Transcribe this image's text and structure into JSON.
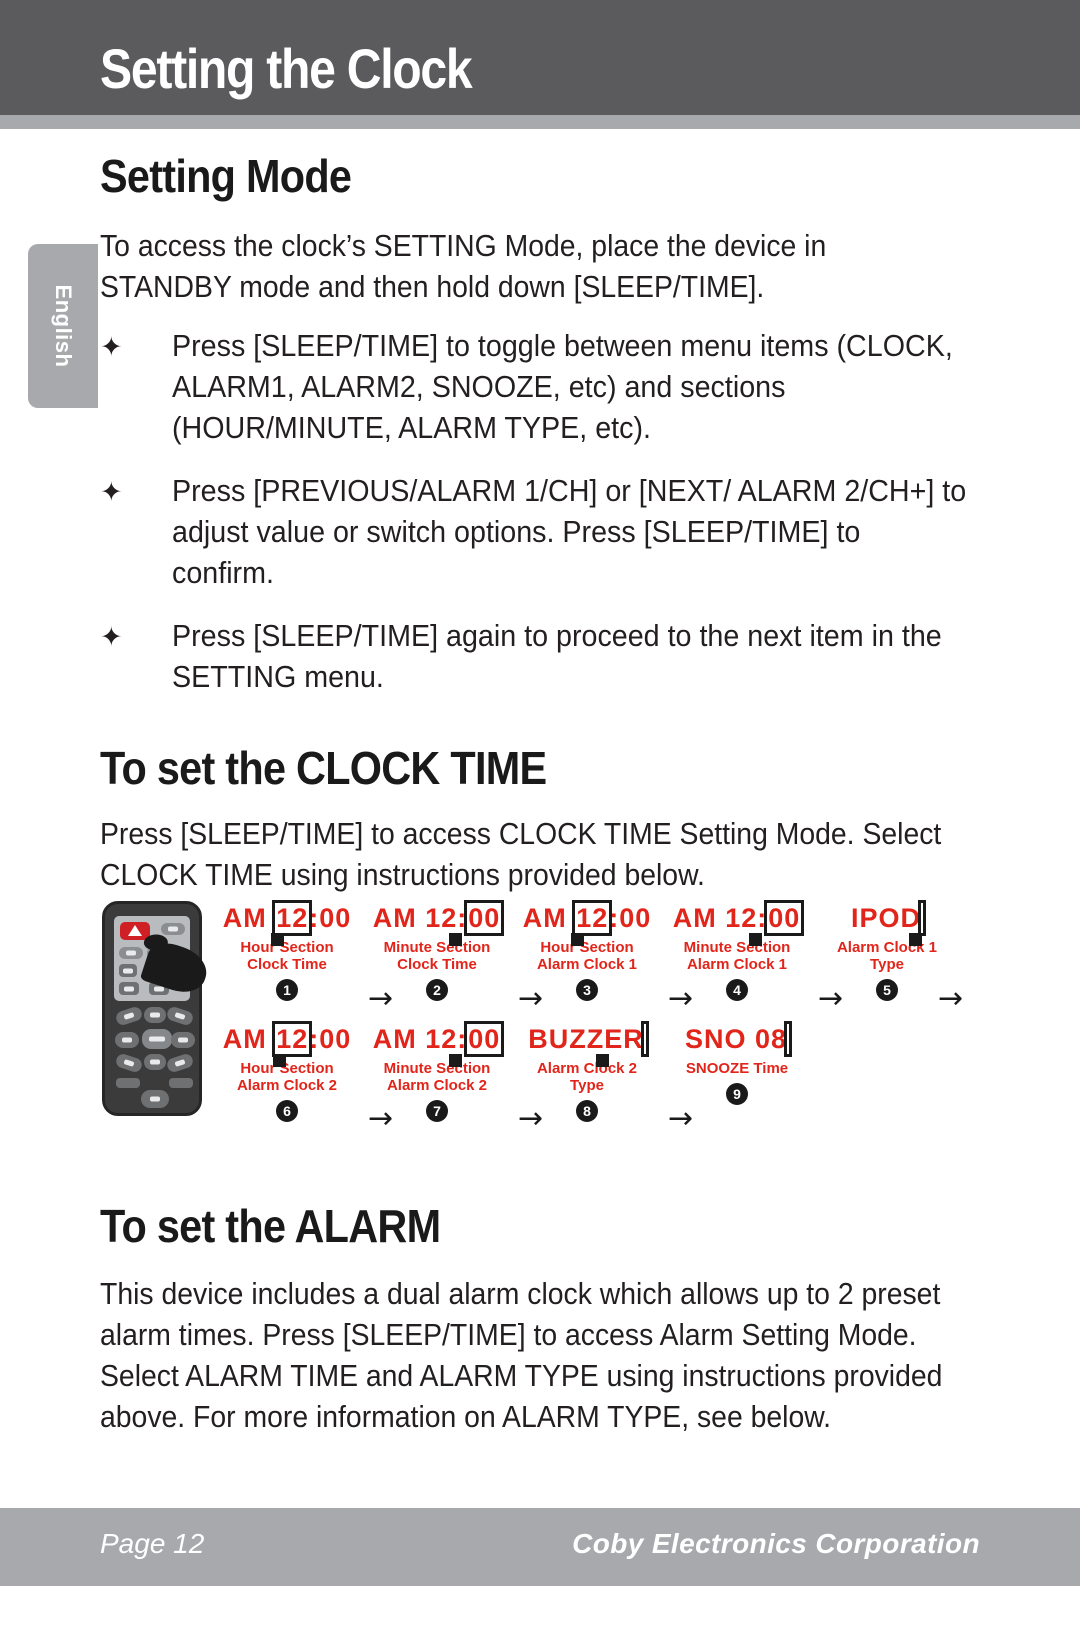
{
  "page": {
    "chapter_title": "Setting the Clock",
    "language_tab": "English",
    "colors": {
      "header_bg": "#5b5b5e",
      "rule_bg": "#a7a9ac",
      "footer_bg": "#a7a9ac",
      "display_red": "#e1251b",
      "text": "#231f20"
    }
  },
  "sections": {
    "setting_mode": {
      "heading": "Setting Mode",
      "intro": "To access the clock’s SETTING Mode, place the device in STANDBY mode and then hold down [SLEEP/TIME].",
      "bullets": [
        "Press [SLEEP/TIME] to toggle between menu items (CLOCK, ALARM1, ALARM2, SNOOZE, etc) and sections (HOUR/MINUTE, ALARM TYPE, etc).",
        "Press [PREVIOUS/ALARM 1/CH] or [NEXT/ ALARM 2/CH+] to adjust value or switch options. Press [SLEEP/TIME] to confirm.",
        "Press [SLEEP/TIME] again to proceed to the next item in the SETTING menu."
      ],
      "bullet_marker": "✦"
    },
    "clock_time": {
      "heading": "To set the CLOCK TIME",
      "paragraph": "Press [SLEEP/TIME] to access CLOCK TIME Setting Mode. Select CLOCK TIME using instructions provided below."
    },
    "alarm": {
      "heading": "To set the ALARM",
      "paragraph": "This device includes a dual alarm clock which allows up to 2 preset alarm times. Press [SLEEP/TIME]  to access Alarm Setting Mode. Select ALARM TIME and ALARM TYPE using instructions provided above.  For more information on ALARM TYPE, see below."
    }
  },
  "diagram": {
    "device_icon": "remote-control",
    "arrow_glyph": "→",
    "steps": [
      {
        "number": "1",
        "display_prefix": "AM ",
        "display_highlight": "12",
        "display_suffix": ":00",
        "label": "Hour Section\nClock Time"
      },
      {
        "number": "2",
        "display_prefix": "AM 12:",
        "display_highlight": "00",
        "display_suffix": "",
        "label": "Minute Section\nClock Time"
      },
      {
        "number": "3",
        "display_prefix": "AM ",
        "display_highlight": "12",
        "display_suffix": ":00",
        "label": "Hour Section\nAlarm Clock 1"
      },
      {
        "number": "4",
        "display_prefix": "AM 12:",
        "display_highlight": "00",
        "display_suffix": "",
        "label": "Minute Section\nAlarm Clock 1"
      },
      {
        "number": "5",
        "display_prefix": "IPOD",
        "display_highlight": "",
        "display_suffix": "",
        "label": "Alarm Clock 1\nType"
      },
      {
        "number": "6",
        "display_prefix": "AM ",
        "display_highlight": "12",
        "display_suffix": ":00",
        "label": "Hour Section\nAlarm Clock 2"
      },
      {
        "number": "7",
        "display_prefix": "AM 12:",
        "display_highlight": "00",
        "display_suffix": "",
        "label": "Minute Section\nAlarm Clock 2"
      },
      {
        "number": "8",
        "display_prefix": "BUZZER",
        "display_highlight": "",
        "display_suffix": "",
        "label": "Alarm Clock 2\nType"
      },
      {
        "number": "9",
        "display_prefix": "SNO 08",
        "display_highlight": "",
        "display_suffix": "",
        "label": "SNOOZE Time"
      }
    ]
  },
  "footer": {
    "page_label": "Page 12",
    "company": "Coby Electronics Corporation"
  }
}
